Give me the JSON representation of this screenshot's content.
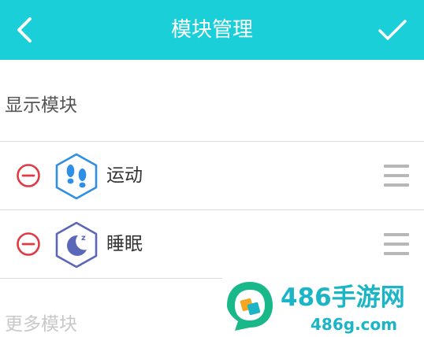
{
  "header": {
    "title": "模块管理",
    "back_icon": "chevron-left-icon",
    "confirm_icon": "checkmark-icon",
    "background": "#1bcfd9"
  },
  "shown_section": {
    "title": "显示模块",
    "items": [
      {
        "label": "运动",
        "icon": "footprints-icon",
        "icon_color": "#2f8fe6"
      },
      {
        "label": "睡眠",
        "icon": "moon-sleep-icon",
        "icon_color": "#5b67b8"
      }
    ]
  },
  "more_section": {
    "title": "更多模块"
  },
  "watermark": {
    "name": "486手游网",
    "domain": "486g.com",
    "color": "#1bb5c6"
  },
  "colors": {
    "remove": "#e03a45",
    "drag_handle": "#b7b7b7",
    "divider": "#dddddd"
  }
}
